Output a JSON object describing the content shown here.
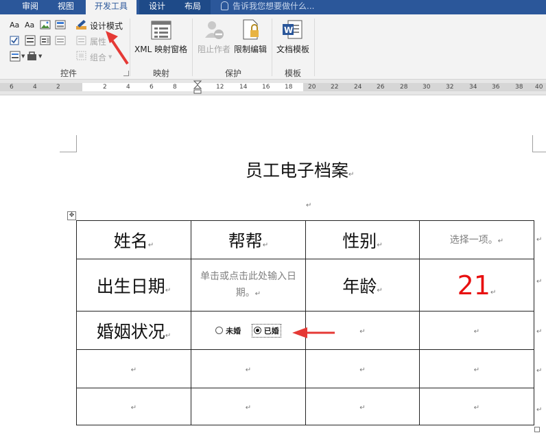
{
  "ribbon_tabs": [
    {
      "label": "审阅"
    },
    {
      "label": "视图"
    },
    {
      "label": "开发工具"
    },
    {
      "label": "设计"
    },
    {
      "label": "布局"
    }
  ],
  "tell_me": "告诉我您想要做什么...",
  "controls_group": {
    "label": "控件",
    "design_mode": "设计模式",
    "properties": "属性",
    "group": "组合"
  },
  "mapping_group": {
    "label": "映射",
    "xml_mapping": "XML 映射窗格"
  },
  "protect_group": {
    "label": "保护",
    "block_authors": "阻止作者",
    "restrict_editing": "限制编辑"
  },
  "templates_group": {
    "label": "模板",
    "document_template": "文档模板"
  },
  "ruler_numbers": [
    "6",
    "4",
    "2",
    "2",
    "4",
    "6",
    "8",
    "12",
    "14",
    "16",
    "18",
    "20",
    "22",
    "24",
    "26",
    "28",
    "30",
    "32",
    "34",
    "36",
    "38",
    "40"
  ],
  "document": {
    "title": "员工电子档案",
    "table": {
      "r1": {
        "name_label": "姓名",
        "name_value": "帮帮",
        "gender_label": "性别",
        "gender_value": "选择一项。"
      },
      "r2": {
        "birth_label": "出生日期",
        "birth_value": "单击或点击此处输入日期。",
        "age_label": "年龄",
        "age_value": "21"
      },
      "r3": {
        "marital_label": "婚姻状况",
        "option_unmarried": "未婚",
        "option_married": "已婚",
        "married_selected": true
      }
    }
  },
  "colors": {
    "ribbon_blue": "#2b579a",
    "age_red": "#e81010",
    "arrow_red": "#e53935"
  }
}
